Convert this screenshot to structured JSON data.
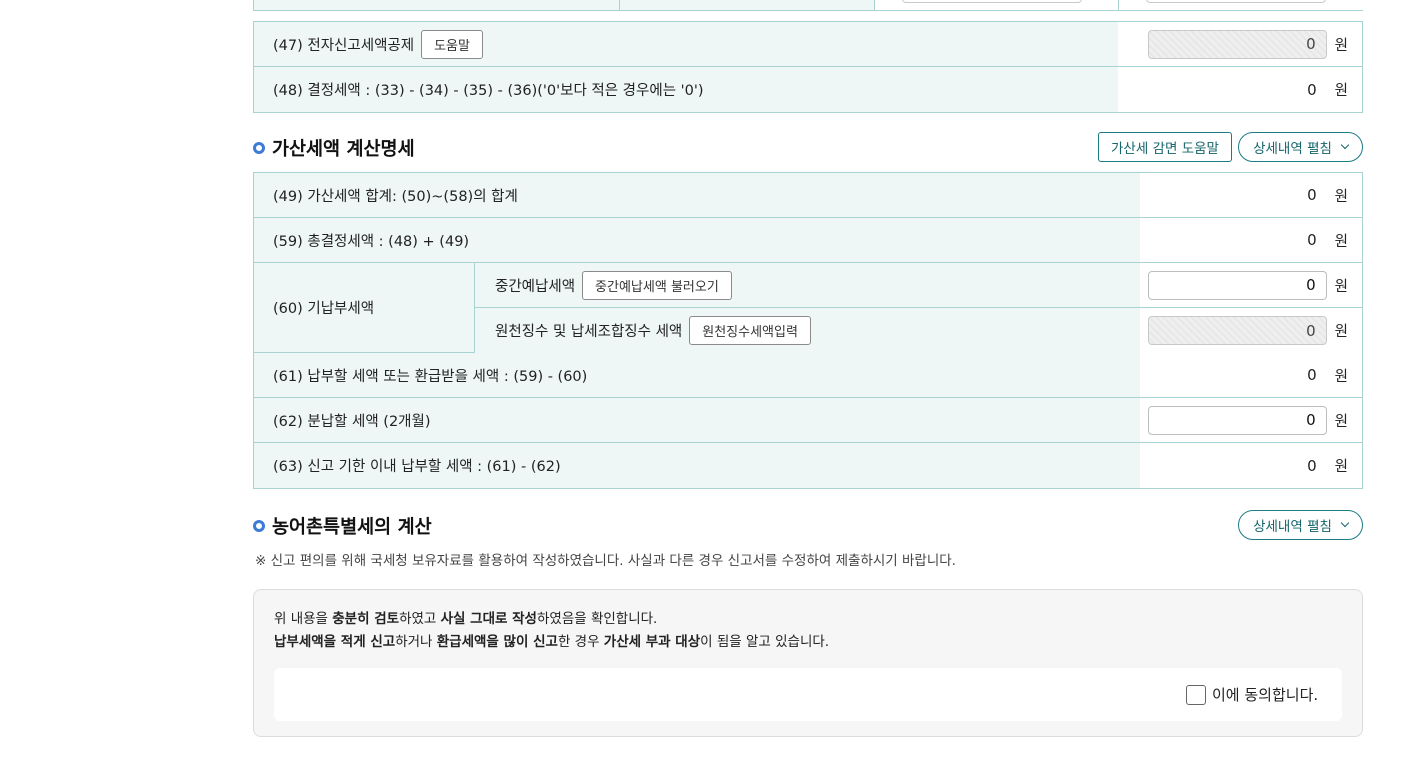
{
  "top_table": {
    "rows": [
      {
        "label": "(47) 전자신고세액공제",
        "help": "도움말",
        "value": "0",
        "unit": "원"
      },
      {
        "label": "(48) 결정세액 : (33) - (34) - (35) - (36)('0'보다 적은 경우에는 '0')",
        "value": "0",
        "unit": "원"
      }
    ]
  },
  "penalty_section": {
    "title": "가산세액 계산명세",
    "help_button": "가산세 감면 도움말",
    "expand_button": "상세내역 펼침",
    "rows": [
      {
        "label": "(49) 가산세액 합계: (50)~(58)의 합계",
        "value": "0",
        "unit": "원"
      },
      {
        "label": "(59) 총결정세액 : (48) + (49)",
        "value": "0",
        "unit": "원"
      },
      {
        "label": "(60) 기납부세액",
        "sub": [
          {
            "label": "중간예납세액",
            "button": "중간예납세액 불러오기",
            "value": "0",
            "unit": "원"
          },
          {
            "label": "원천징수 및 납세조합징수 세액",
            "button": "원천징수세액입력",
            "value": "0",
            "unit": "원"
          }
        ]
      },
      {
        "label": "(61) 납부할 세액 또는 환급받을 세액 : (59) - (60)",
        "value": "0",
        "unit": "원"
      },
      {
        "label": "(62) 분납할 세액 (2개월)",
        "value": "0",
        "unit": "원"
      },
      {
        "label": "(63) 신고 기한 이내 납부할 세액 : (61) - (62)",
        "value": "0",
        "unit": "원"
      }
    ]
  },
  "rural_section": {
    "title": "농어촌특별세의 계산",
    "expand_button": "상세내역 펼침"
  },
  "notice": "※ 신고 편의를 위해 국세청 보유자료를 활용하여 작성하였습니다. 사실과 다른 경우 신고서를 수정하여 제출하시기 바랍니다.",
  "confirm": {
    "l1": [
      "위 내용을 ",
      "충분히 검토",
      "하였고 ",
      "사실 그대로 작성",
      "하였음을 확인합니다."
    ],
    "l2": [
      "납부세액을 적게 신고",
      "하거나 ",
      "환급세액을 많이 신고",
      "한 경우 ",
      "가산세 부과 대상",
      "이 됨을 알고 있습니다."
    ],
    "agree_label": "이에 동의합니다.",
    "agree_checked": false
  },
  "colors": {
    "border": "#a9d3d2",
    "label_bg": "#eef7f6",
    "accent": "#1b7c83",
    "dot": "#3d7bd6"
  }
}
